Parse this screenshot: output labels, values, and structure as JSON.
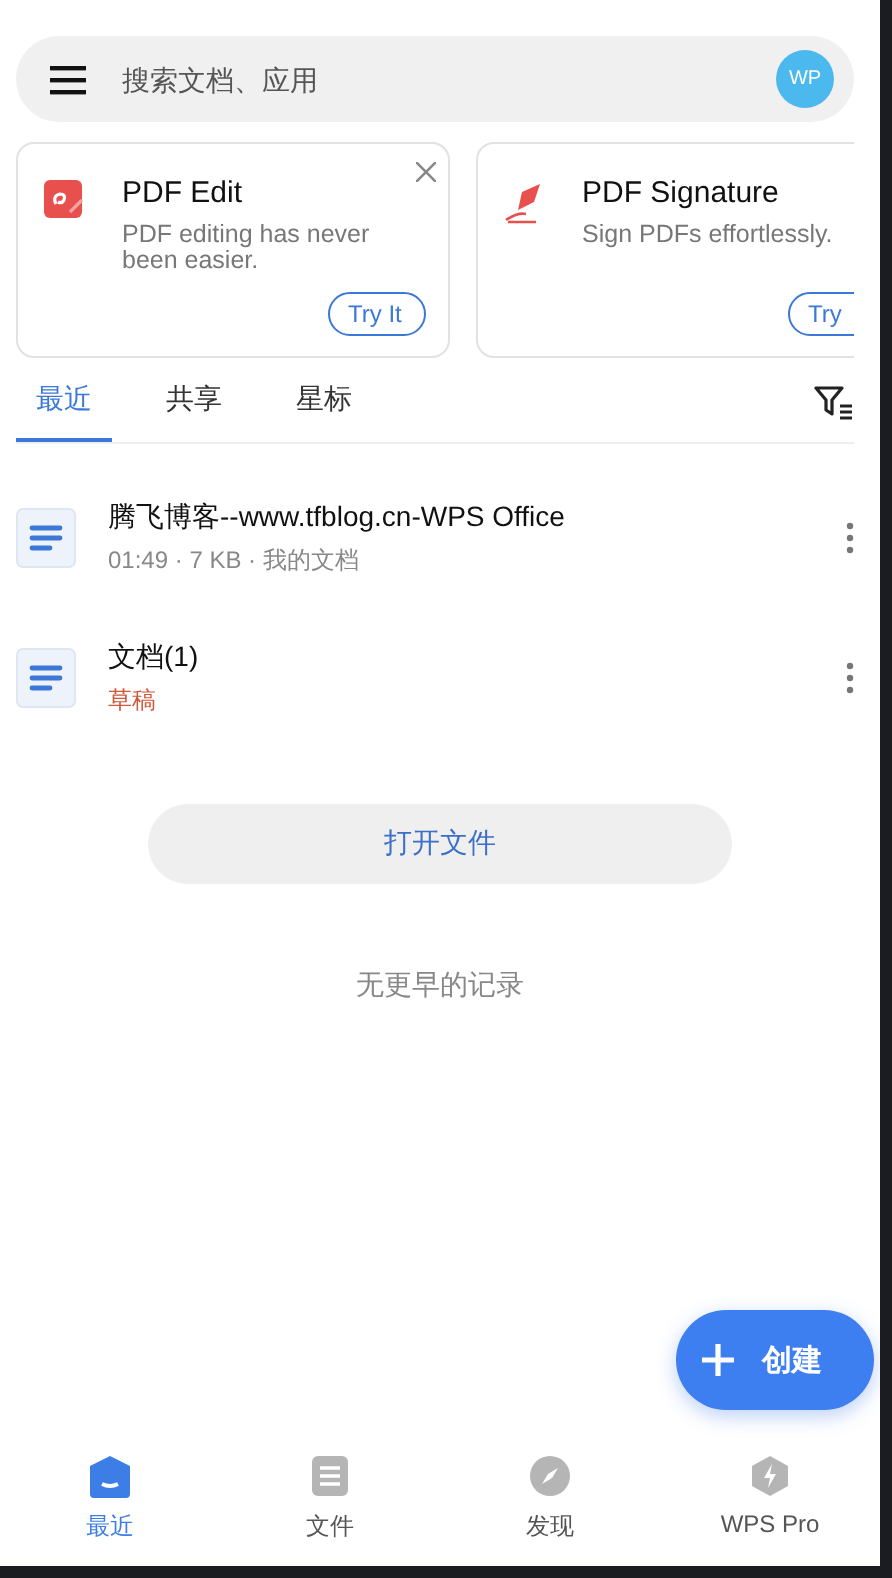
{
  "search_bar": {
    "placeholder": "搜索文档、应用",
    "avatar": "WP"
  },
  "promo_cards": [
    {
      "kind": "edit",
      "title": "PDF Edit",
      "text": "PDF editing has never been easier.",
      "button": "Try It",
      "closable": true
    },
    {
      "kind": "signature",
      "title": "PDF Signature",
      "text": "Sign PDFs effortlessly.",
      "button": "Try"
    }
  ],
  "tabs": [
    {
      "label": "最近",
      "selected": true
    },
    {
      "label": "共享",
      "selected": false
    },
    {
      "label": "星标",
      "selected": false
    }
  ],
  "files": [
    {
      "name": "腾飞博客--www.tfblog.cn-WPS Office",
      "meta": "01:49 · 7 KB · 我的文档",
      "kind": "info"
    },
    {
      "name": "文档(1)",
      "meta": "草稿",
      "kind": "draft"
    }
  ],
  "open_button": "打开文件",
  "end_note": "无更早的记录",
  "fab": "创建",
  "bottom_nav": [
    {
      "label": "最近",
      "kind": "home",
      "selected": true
    },
    {
      "label": "文件",
      "kind": "files",
      "selected": false
    },
    {
      "label": "发现",
      "kind": "discover",
      "selected": false
    },
    {
      "label": "WPS Pro",
      "kind": "pro",
      "selected": false
    }
  ]
}
